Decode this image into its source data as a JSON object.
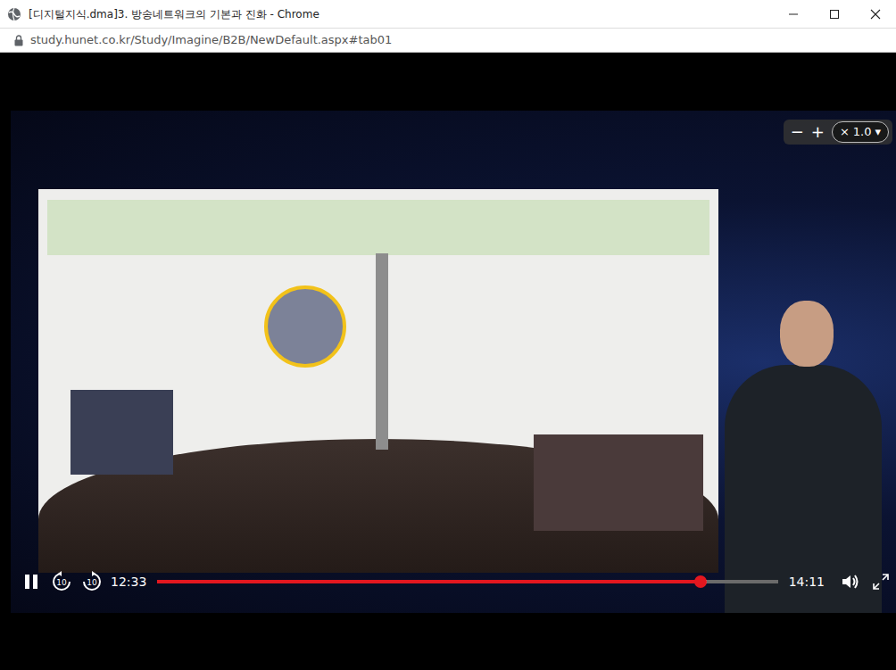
{
  "window": {
    "title": "[디지털지식.dma]3. 방송네트워크의 기본과 진화 - Chrome"
  },
  "address": {
    "url": "study.hunet.co.kr/Study/Imagine/B2B/NewDefault.aspx#tab01"
  },
  "player": {
    "playing": true,
    "rewind_label": "10",
    "forward_label": "10",
    "current_time": "12:33",
    "duration": "14:11",
    "progress": {
      "level": 0.875,
      "buffered": 0.885
    },
    "speed": {
      "minus": "−",
      "plus": "+",
      "close": "×",
      "value": "1.0",
      "caret": "▾"
    }
  }
}
